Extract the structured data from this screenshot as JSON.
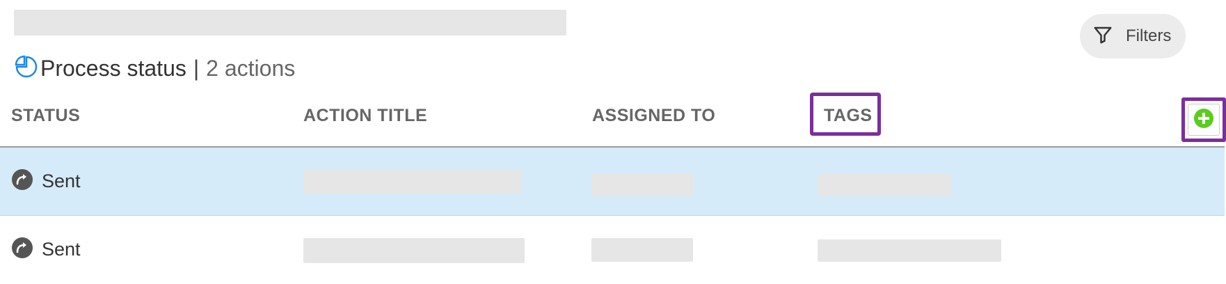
{
  "toolbar": {
    "filters_label": "Filters"
  },
  "process_status": {
    "label": "Process status",
    "separator": "|",
    "count_label": "2 actions"
  },
  "table": {
    "columns": [
      "STATUS",
      "ACTION TITLE",
      "ASSIGNED TO",
      "TAGS"
    ],
    "rows": [
      {
        "status": "Sent",
        "selected": true
      },
      {
        "status": "Sent",
        "selected": false
      }
    ]
  },
  "icons": {
    "filters": "funnel-icon",
    "process_status": "pie-chart-icon",
    "status_sent": "forward-arrow-icon",
    "add_column": "plus-circle-icon"
  },
  "colors": {
    "accent_blue": "#1e88e5",
    "selected_row": "#d6ebfa",
    "highlight": "#7a2f9c",
    "add_green": "#5ccc1f",
    "placeholder": "#e6e6e6"
  }
}
